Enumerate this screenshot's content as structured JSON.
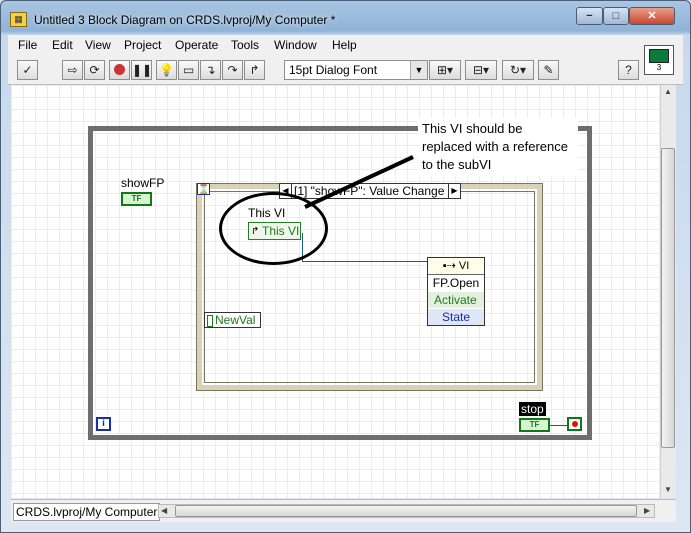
{
  "window": {
    "title": "Untitled 3 Block Diagram on CRDS.lvproj/My Computer *",
    "min_glyph": "−",
    "max_glyph": "□",
    "close_glyph": "✕"
  },
  "menu": {
    "items": [
      "File",
      "Edit",
      "View",
      "Project",
      "Operate",
      "Tools",
      "Window",
      "Help"
    ]
  },
  "toolbar": {
    "font_select_value": "15pt Dialog Font",
    "help_glyph": "?"
  },
  "vi_icon": {
    "number": "3"
  },
  "diagram": {
    "showfp_label": "showFP",
    "bool_terminal_text": "TF",
    "event_case_label": "[1] \"showFP\": Value Change",
    "this_vi_label": "This VI",
    "this_vi_value": "This VI",
    "newval_label": "NewVal",
    "property_node": {
      "class": "VI",
      "rows": [
        "FP.Open",
        "Activate",
        "State"
      ]
    },
    "annotation_text": "This VI should be replaced with a reference to the subVI",
    "stop_label": "stop",
    "iteration_glyph": "i"
  },
  "status_bar": {
    "context": "CRDS.lvproj/My Computer"
  }
}
